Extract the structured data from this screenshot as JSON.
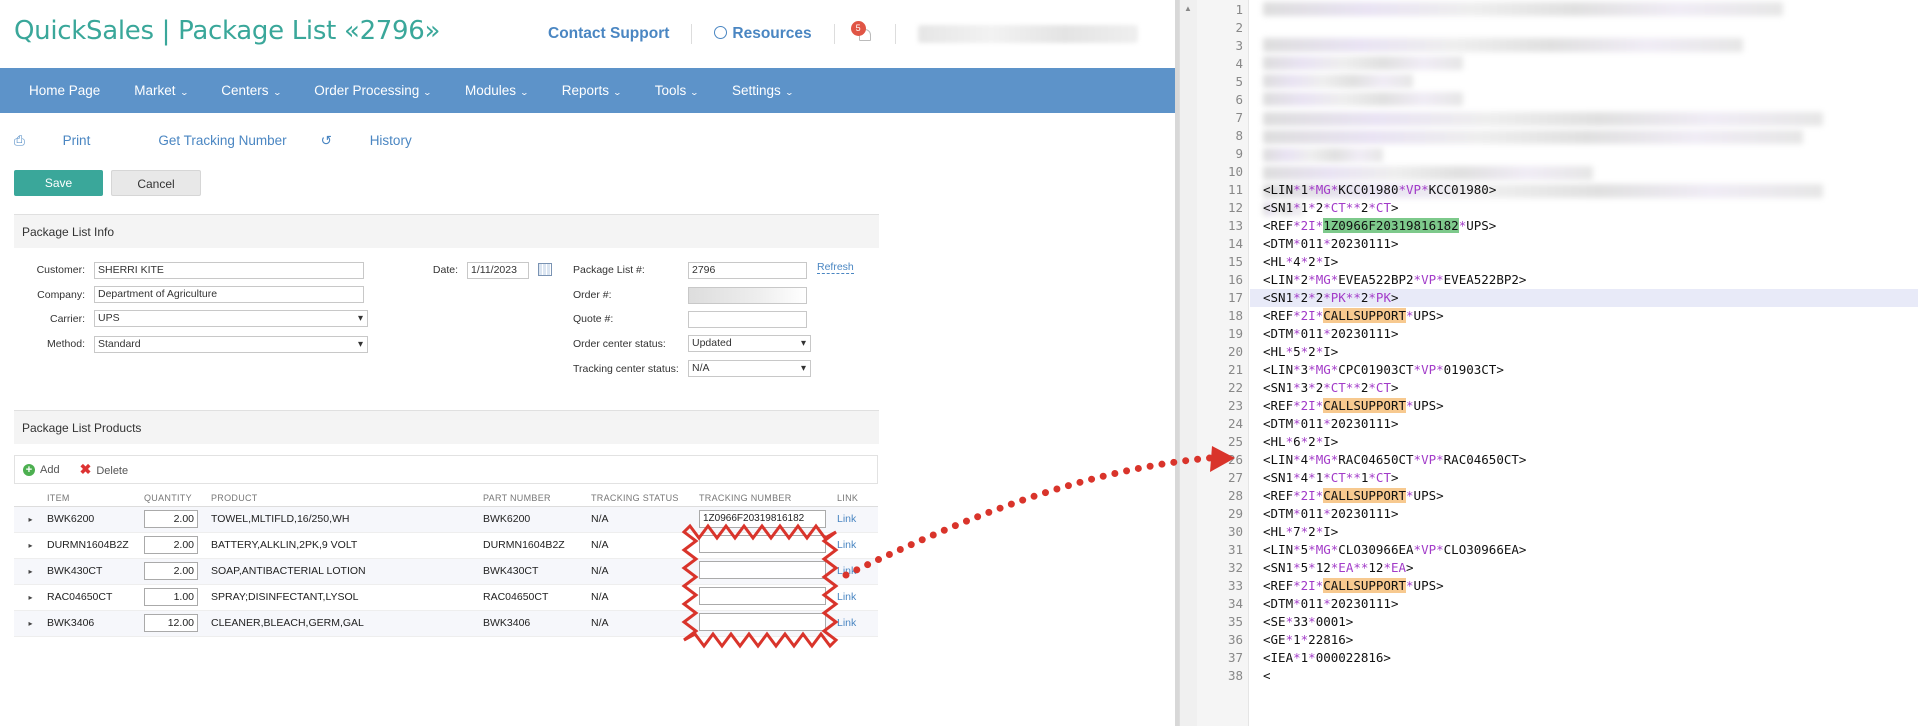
{
  "header": {
    "title": "QuickSales | Package List «2796»",
    "contact_support": "Contact Support",
    "resources": "Resources",
    "notifications_count": "5"
  },
  "nav": {
    "items": [
      {
        "label": "Home Page"
      },
      {
        "label": "Market"
      },
      {
        "label": "Centers"
      },
      {
        "label": "Order Processing"
      },
      {
        "label": "Modules"
      },
      {
        "label": "Reports"
      },
      {
        "label": "Tools"
      },
      {
        "label": "Settings"
      }
    ]
  },
  "actions": {
    "print": "Print",
    "get_tracking": "Get Tracking Number",
    "history": "History",
    "save": "Save",
    "cancel": "Cancel"
  },
  "info": {
    "heading": "Package List Info",
    "customer_label": "Customer:",
    "customer": "SHERRI KITE",
    "company_label": "Company:",
    "company": "Department of Agriculture",
    "carrier_label": "Carrier:",
    "carrier": "UPS",
    "method_label": "Method:",
    "method": "Standard",
    "date_label": "Date:",
    "date": "1/11/2023",
    "package_list_label": "Package List #:",
    "package_list": "2796",
    "refresh": "Refresh",
    "order_label": "Order #:",
    "quote_label": "Quote #:",
    "order_center_label": "Order center status:",
    "order_center": "Updated",
    "tracking_center_label": "Tracking center status:",
    "tracking_center": "N/A"
  },
  "products": {
    "heading": "Package List Products",
    "add": "Add",
    "delete": "Delete",
    "columns": [
      "ITEM",
      "QUANTITY",
      "PRODUCT",
      "PART NUMBER",
      "TRACKING STATUS",
      "TRACKING NUMBER",
      "LINK"
    ],
    "rows": [
      {
        "item": "BWK6200",
        "qty": "2.00",
        "product": "TOWEL,MLTIFLD,16/250,WH",
        "part": "BWK6200",
        "status": "N/A",
        "tracking": "1Z0966F20319816182",
        "link": "Link"
      },
      {
        "item": "DURMN1604B2Z",
        "qty": "2.00",
        "product": "BATTERY,ALKLIN,2PK,9 VOLT",
        "part": "DURMN1604B2Z",
        "status": "N/A",
        "tracking": "",
        "link": "Link"
      },
      {
        "item": "BWK430CT",
        "qty": "2.00",
        "product": "SOAP,ANTIBACTERIAL LOTION",
        "part": "BWK430CT",
        "status": "N/A",
        "tracking": "",
        "link": "Link"
      },
      {
        "item": "RAC04650CT",
        "qty": "1.00",
        "product": "SPRAY;DISINFECTANT,LYSOL",
        "part": "RAC04650CT",
        "status": "N/A",
        "tracking": "",
        "link": "Link"
      },
      {
        "item": "BWK3406",
        "qty": "12.00",
        "product": "CLEANER,BLEACH,GERM,GAL",
        "part": "BWK3406",
        "status": "N/A",
        "tracking": "",
        "link": "Link"
      }
    ]
  },
  "editor": {
    "line_numbers": [
      "1",
      "2",
      "3",
      "4",
      "5",
      "6",
      "7",
      "8",
      "9",
      "10",
      "11",
      "12",
      "13",
      "14",
      "15",
      "16",
      "17",
      "18",
      "19",
      "20",
      "21",
      "22",
      "23",
      "24",
      "25",
      "26",
      "27",
      "28",
      "29",
      "30",
      "31",
      "32",
      "33",
      "34",
      "35",
      "36",
      "37",
      "38"
    ],
    "lines": [
      {
        "n": 11,
        "parts": [
          [
            "",
            "<LIN"
          ],
          [
            "s",
            "*"
          ],
          [
            "",
            "1"
          ],
          [
            "s",
            "*MG*"
          ],
          [
            "",
            "KCC01980"
          ],
          [
            "s",
            "*VP*"
          ],
          [
            "",
            "KCC01980>"
          ]
        ]
      },
      {
        "n": 12,
        "parts": [
          [
            "",
            "<SN1"
          ],
          [
            "s",
            "*"
          ],
          [
            "",
            "1"
          ],
          [
            "s",
            "*"
          ],
          [
            "",
            "2"
          ],
          [
            "s",
            "*CT**"
          ],
          [
            "",
            "2"
          ],
          [
            "s",
            "*CT"
          ],
          [
            "",
            ">"
          ]
        ]
      },
      {
        "n": 13,
        "parts": [
          [
            "",
            "<REF"
          ],
          [
            "s",
            "*2I*"
          ],
          [
            "hg",
            "1Z0966F20319816182"
          ],
          [
            "s",
            "*"
          ],
          [
            "",
            "UPS>"
          ]
        ]
      },
      {
        "n": 14,
        "parts": [
          [
            "",
            "<DTM"
          ],
          [
            "s",
            "*"
          ],
          [
            "",
            "011"
          ],
          [
            "s",
            "*"
          ],
          [
            "",
            "20230111>"
          ]
        ]
      },
      {
        "n": 15,
        "parts": [
          [
            "",
            "<HL"
          ],
          [
            "s",
            "*"
          ],
          [
            "",
            "4"
          ],
          [
            "s",
            "*"
          ],
          [
            "",
            "2"
          ],
          [
            "s",
            "*"
          ],
          [
            "",
            "I>"
          ]
        ]
      },
      {
        "n": 16,
        "parts": [
          [
            "",
            "<LIN"
          ],
          [
            "s",
            "*"
          ],
          [
            "",
            "2"
          ],
          [
            "s",
            "*MG*"
          ],
          [
            "",
            "EVEA522BP2"
          ],
          [
            "s",
            "*VP*"
          ],
          [
            "",
            "EVEA522BP2>"
          ]
        ]
      },
      {
        "n": 17,
        "parts": [
          [
            "",
            "<SN1"
          ],
          [
            "s",
            "*"
          ],
          [
            "",
            "2"
          ],
          [
            "s",
            "*"
          ],
          [
            "",
            "2"
          ],
          [
            "s",
            "*PK**"
          ],
          [
            "",
            "2"
          ],
          [
            "s",
            "*PK"
          ],
          [
            "",
            ">"
          ]
        ]
      },
      {
        "n": 18,
        "parts": [
          [
            "",
            "<REF"
          ],
          [
            "s",
            "*2I*"
          ],
          [
            "ho",
            "CALLSUPPORT"
          ],
          [
            "s",
            "*"
          ],
          [
            "",
            "UPS>"
          ]
        ]
      },
      {
        "n": 19,
        "parts": [
          [
            "",
            "<DTM"
          ],
          [
            "s",
            "*"
          ],
          [
            "",
            "011"
          ],
          [
            "s",
            "*"
          ],
          [
            "",
            "20230111>"
          ]
        ]
      },
      {
        "n": 20,
        "parts": [
          [
            "",
            "<HL"
          ],
          [
            "s",
            "*"
          ],
          [
            "",
            "5"
          ],
          [
            "s",
            "*"
          ],
          [
            "",
            "2"
          ],
          [
            "s",
            "*"
          ],
          [
            "",
            "I>"
          ]
        ]
      },
      {
        "n": 21,
        "parts": [
          [
            "",
            "<LIN"
          ],
          [
            "s",
            "*"
          ],
          [
            "",
            "3"
          ],
          [
            "s",
            "*MG*"
          ],
          [
            "",
            "CPC01903CT"
          ],
          [
            "s",
            "*VP*"
          ],
          [
            "",
            "01903CT>"
          ]
        ]
      },
      {
        "n": 22,
        "parts": [
          [
            "",
            "<SN1"
          ],
          [
            "s",
            "*"
          ],
          [
            "",
            "3"
          ],
          [
            "s",
            "*"
          ],
          [
            "",
            "2"
          ],
          [
            "s",
            "*CT**"
          ],
          [
            "",
            "2"
          ],
          [
            "s",
            "*CT"
          ],
          [
            "",
            ">"
          ]
        ]
      },
      {
        "n": 23,
        "parts": [
          [
            "",
            "<REF"
          ],
          [
            "s",
            "*2I*"
          ],
          [
            "ho",
            "CALLSUPPORT"
          ],
          [
            "s",
            "*"
          ],
          [
            "",
            "UPS>"
          ]
        ]
      },
      {
        "n": 24,
        "parts": [
          [
            "",
            "<DTM"
          ],
          [
            "s",
            "*"
          ],
          [
            "",
            "011"
          ],
          [
            "s",
            "*"
          ],
          [
            "",
            "20230111>"
          ]
        ]
      },
      {
        "n": 25,
        "parts": [
          [
            "",
            "<HL"
          ],
          [
            "s",
            "*"
          ],
          [
            "",
            "6"
          ],
          [
            "s",
            "*"
          ],
          [
            "",
            "2"
          ],
          [
            "s",
            "*"
          ],
          [
            "",
            "I>"
          ]
        ]
      },
      {
        "n": 26,
        "parts": [
          [
            "",
            "<LIN"
          ],
          [
            "s",
            "*"
          ],
          [
            "",
            "4"
          ],
          [
            "s",
            "*MG*"
          ],
          [
            "",
            "RAC04650CT"
          ],
          [
            "s",
            "*VP*"
          ],
          [
            "",
            "RAC04650CT>"
          ]
        ]
      },
      {
        "n": 27,
        "parts": [
          [
            "",
            "<SN1"
          ],
          [
            "s",
            "*"
          ],
          [
            "",
            "4"
          ],
          [
            "s",
            "*"
          ],
          [
            "",
            "1"
          ],
          [
            "s",
            "*CT**"
          ],
          [
            "",
            "1"
          ],
          [
            "s",
            "*CT"
          ],
          [
            "",
            ">"
          ]
        ]
      },
      {
        "n": 28,
        "parts": [
          [
            "",
            "<REF"
          ],
          [
            "s",
            "*2I*"
          ],
          [
            "ho",
            "CALLSUPPORT"
          ],
          [
            "s",
            "*"
          ],
          [
            "",
            "UPS>"
          ]
        ]
      },
      {
        "n": 29,
        "parts": [
          [
            "",
            "<DTM"
          ],
          [
            "s",
            "*"
          ],
          [
            "",
            "011"
          ],
          [
            "s",
            "*"
          ],
          [
            "",
            "20230111>"
          ]
        ]
      },
      {
        "n": 30,
        "parts": [
          [
            "",
            "<HL"
          ],
          [
            "s",
            "*"
          ],
          [
            "",
            "7"
          ],
          [
            "s",
            "*"
          ],
          [
            "",
            "2"
          ],
          [
            "s",
            "*"
          ],
          [
            "",
            "I>"
          ]
        ]
      },
      {
        "n": 31,
        "parts": [
          [
            "",
            "<LIN"
          ],
          [
            "s",
            "*"
          ],
          [
            "",
            "5"
          ],
          [
            "s",
            "*MG*"
          ],
          [
            "",
            "CLO30966EA"
          ],
          [
            "s",
            "*VP*"
          ],
          [
            "",
            "CLO30966EA>"
          ]
        ]
      },
      {
        "n": 32,
        "parts": [
          [
            "",
            "<SN1"
          ],
          [
            "s",
            "*"
          ],
          [
            "",
            "5"
          ],
          [
            "s",
            "*"
          ],
          [
            "",
            "12"
          ],
          [
            "s",
            "*EA**"
          ],
          [
            "",
            "12"
          ],
          [
            "s",
            "*EA"
          ],
          [
            "",
            ">"
          ]
        ]
      },
      {
        "n": 33,
        "parts": [
          [
            "",
            "<REF"
          ],
          [
            "s",
            "*2I*"
          ],
          [
            "ho",
            "CALLSUPPORT"
          ],
          [
            "s",
            "*"
          ],
          [
            "",
            "UPS>"
          ]
        ]
      },
      {
        "n": 34,
        "parts": [
          [
            "",
            "<DTM"
          ],
          [
            "s",
            "*"
          ],
          [
            "",
            "011"
          ],
          [
            "s",
            "*"
          ],
          [
            "",
            "20230111>"
          ]
        ]
      },
      {
        "n": 35,
        "parts": [
          [
            "",
            "<SE"
          ],
          [
            "s",
            "*"
          ],
          [
            "",
            "33"
          ],
          [
            "s",
            "*"
          ],
          [
            "",
            "0001>"
          ]
        ]
      },
      {
        "n": 36,
        "parts": [
          [
            "",
            "<GE"
          ],
          [
            "s",
            "*"
          ],
          [
            "",
            "1"
          ],
          [
            "s",
            "*"
          ],
          [
            "",
            "22816>"
          ]
        ]
      },
      {
        "n": 37,
        "parts": [
          [
            "",
            "<IEA"
          ],
          [
            "s",
            "*"
          ],
          [
            "",
            "1"
          ],
          [
            "s",
            "*"
          ],
          [
            "",
            "000022816>"
          ]
        ]
      },
      {
        "n": 38,
        "parts": [
          [
            "",
            "<"
          ]
        ]
      }
    ]
  },
  "colors": {
    "brand": "#3aa79a",
    "nav": "#5d93c9",
    "link": "#4a86c2",
    "annotation": "#d9342b",
    "edi_separator": "#a23bc8",
    "highlight_green": "#7dc98b",
    "highlight_orange": "#f7c98f"
  }
}
